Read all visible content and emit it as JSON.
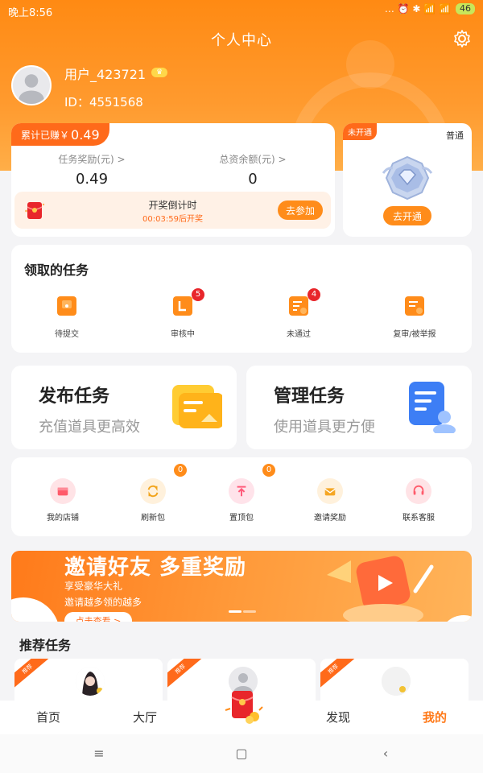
{
  "status_bar": {
    "time": "晚上8:56",
    "icons": "… ⏰ ✱ 📶 📶",
    "battery": "46"
  },
  "header": {
    "title": "个人中心"
  },
  "user": {
    "name": "用户_423721",
    "badge": "",
    "id_label": "ID：4551568"
  },
  "earnings": {
    "total_label": "累计已赚￥",
    "total_value": "0.49",
    "task_reward_label": "任务奖励(元) >",
    "task_reward_value": "0.49",
    "balance_label": "总资余额(元) >",
    "balance_value": "0",
    "countdown_title": "开奖倒计时",
    "countdown_sub": "00:03:59后开奖",
    "join_button": "去参加"
  },
  "vip": {
    "status_tag": "未开通",
    "level": "普通",
    "open_button": "去开通"
  },
  "my_tasks": {
    "title": "领取的任务",
    "items": [
      {
        "label": "待提交",
        "badge": ""
      },
      {
        "label": "审核中",
        "badge": "5"
      },
      {
        "label": "未通过",
        "badge": "4"
      },
      {
        "label": "复审/被举报",
        "badge": ""
      }
    ]
  },
  "publish": {
    "title": "发布任务",
    "subtitle": "充值道具更高效"
  },
  "manage": {
    "title": "管理任务",
    "subtitle": "使用道具更方便"
  },
  "tools": {
    "items": [
      {
        "label": "我的店铺",
        "badge": "",
        "color": "#ffe3e6",
        "fg": "#ff5a6a"
      },
      {
        "label": "刷新包",
        "badge": "0",
        "color": "#fff1dc",
        "fg": "#f2a41c"
      },
      {
        "label": "置顶包",
        "badge": "0",
        "color": "#ffe3ea",
        "fg": "#ff5a7a"
      },
      {
        "label": "邀请奖励",
        "badge": "",
        "color": "#fff1dc",
        "fg": "#f5a623"
      },
      {
        "label": "联系客服",
        "badge": "",
        "color": "#ffe3e6",
        "fg": "#ff5a6a"
      }
    ]
  },
  "banner": {
    "title": "邀请好友 多重奖励",
    "sub1": "享受豪华大礼",
    "sub2": "邀请越多领的越多",
    "button": "点击查看 >"
  },
  "recommend": {
    "title": "推荐任务",
    "corner": "推荐"
  },
  "tabbar": {
    "items": [
      "首页",
      "大厅",
      "",
      "发现",
      "我的"
    ]
  },
  "colors": {
    "accent": "#ff7a1a",
    "badge_red": "#e8262b"
  }
}
